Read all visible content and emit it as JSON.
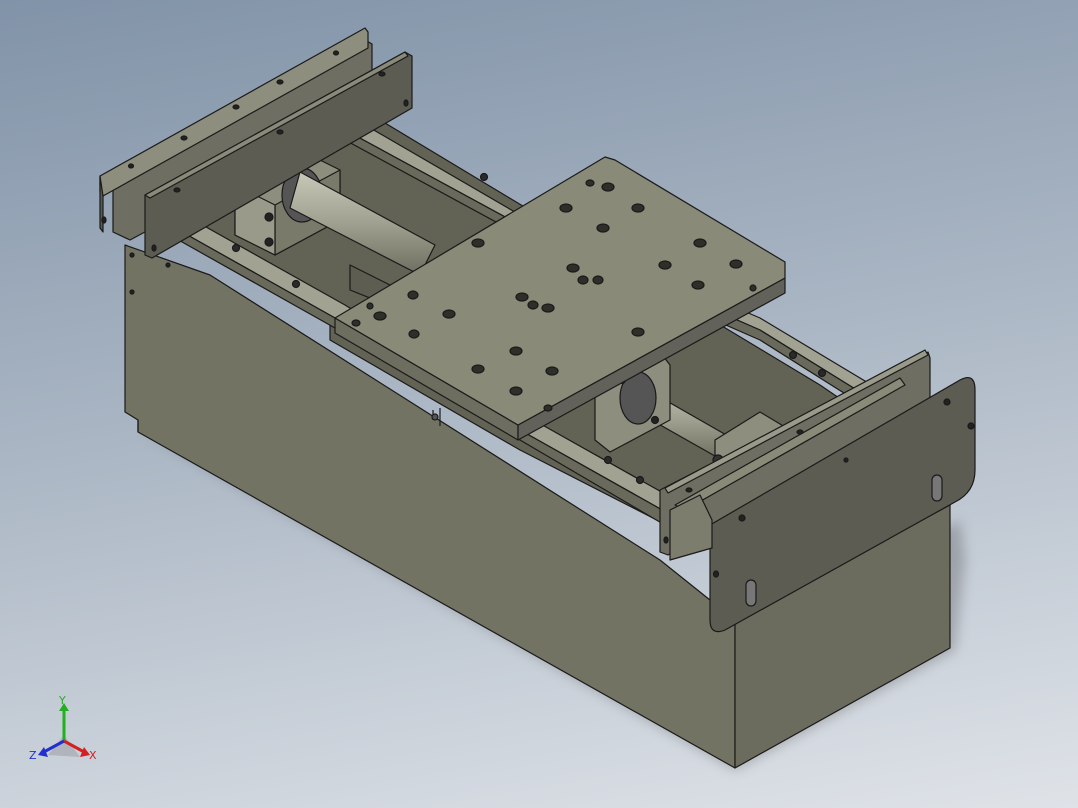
{
  "viewport": {
    "background_top": "#8193a8",
    "background_bottom": "#dfe3e8"
  },
  "model": {
    "description_colors": {
      "body": "#737363",
      "plate": "#8a8a78",
      "endplate": "#5a5a52",
      "rod": "#a3a393",
      "edge": "#1a1a1a"
    }
  },
  "triad": {
    "x_label": "X",
    "y_label": "Y",
    "z_label": "Z",
    "x_color": "#d42020",
    "y_color": "#20b020",
    "z_color": "#2030d0"
  }
}
